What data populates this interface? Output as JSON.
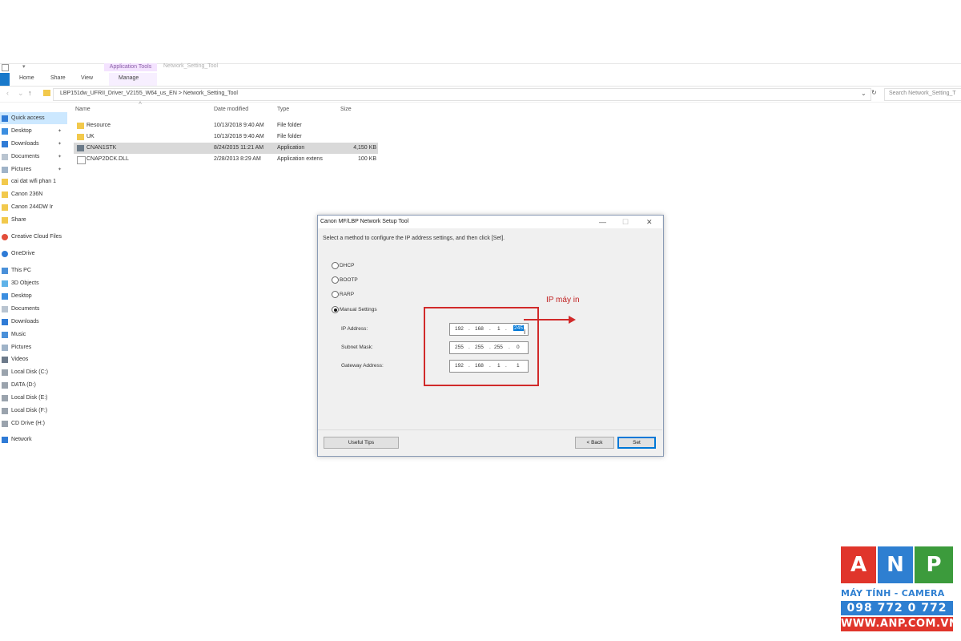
{
  "ribbon": {
    "contextual_tab": "Application Tools",
    "window_title": "Network_Setting_Tool",
    "tabs": [
      "Home",
      "Share",
      "View",
      "Manage"
    ]
  },
  "address": {
    "crumbs": "LBP151dw_UFRII_Driver_V2155_W64_us_EN  >  Network_Setting_Tool",
    "search_placeholder": "Search Network_Setting_T"
  },
  "sidebar": {
    "items": [
      {
        "label": "Quick access",
        "icon": "star-icon",
        "selected": true
      },
      {
        "label": "Desktop",
        "icon": "desktop-icon",
        "pinned": true
      },
      {
        "label": "Downloads",
        "icon": "download-icon",
        "pinned": true
      },
      {
        "label": "Documents",
        "icon": "documents-icon",
        "pinned": true
      },
      {
        "label": "Pictures",
        "icon": "pictures-icon",
        "pinned": true
      },
      {
        "label": "cai dat wifi phan 1",
        "icon": "folder-icon"
      },
      {
        "label": "Canon 236N",
        "icon": "folder-icon"
      },
      {
        "label": "Canon 244DW Ir",
        "icon": "folder-icon"
      },
      {
        "label": "Share",
        "icon": "folder-icon"
      },
      {
        "label": "Creative Cloud Files",
        "icon": "cloud-icon"
      },
      {
        "label": "OneDrive",
        "icon": "onedrive-icon"
      },
      {
        "label": "This PC",
        "icon": "computer-icon"
      },
      {
        "label": "3D Objects",
        "icon": "cube-icon"
      },
      {
        "label": "Desktop",
        "icon": "desktop-icon"
      },
      {
        "label": "Documents",
        "icon": "documents-icon"
      },
      {
        "label": "Downloads",
        "icon": "download-icon"
      },
      {
        "label": "Music",
        "icon": "music-icon"
      },
      {
        "label": "Pictures",
        "icon": "pictures-icon"
      },
      {
        "label": "Videos",
        "icon": "videos-icon"
      },
      {
        "label": "Local Disk (C:)",
        "icon": "drive-icon"
      },
      {
        "label": "DATA (D:)",
        "icon": "drive-icon"
      },
      {
        "label": "Local Disk (E:)",
        "icon": "drive-icon"
      },
      {
        "label": "Local Disk (F:)",
        "icon": "drive-icon"
      },
      {
        "label": "CD Drive (H:)",
        "icon": "cd-drive-icon"
      },
      {
        "label": "Network",
        "icon": "network-icon"
      }
    ]
  },
  "files": {
    "columns": [
      "Name",
      "Date modified",
      "Type",
      "Size"
    ],
    "rows": [
      {
        "name": "Resource",
        "date": "10/13/2018 9:40 AM",
        "type": "File folder",
        "size": "",
        "icon": "folder-icon"
      },
      {
        "name": "UK",
        "date": "10/13/2018 9:40 AM",
        "type": "File folder",
        "size": "",
        "icon": "folder-icon"
      },
      {
        "name": "CNAN1STK",
        "date": "8/24/2015 11:21 AM",
        "type": "Application",
        "size": "4,150 KB",
        "icon": "application-icon",
        "selected": true
      },
      {
        "name": "CNAP2DCK.DLL",
        "date": "2/28/2013 8:29 AM",
        "type": "Application extens",
        "size": "100 KB",
        "icon": "dll-icon"
      }
    ]
  },
  "dialog": {
    "title": "Canon MF/LBP Network Setup Tool",
    "instruction": "Select a method to configure the IP address settings, and then click [Set].",
    "options": [
      "DHCP",
      "BOOTP",
      "RARP",
      "Manual Settings"
    ],
    "selected_option": "Manual Settings",
    "fields": [
      {
        "label": "IP Address:",
        "octets": [
          "192",
          "168",
          "1",
          "245"
        ]
      },
      {
        "label": "Subnet Mask:",
        "octets": [
          "255",
          "255",
          "255",
          "0"
        ]
      },
      {
        "label": "Gateway Address:",
        "octets": [
          "192",
          "168",
          "1",
          "1"
        ]
      }
    ],
    "buttons": {
      "tips": "Useful Tips",
      "back": "< Back",
      "set": "Set"
    }
  },
  "annotation": {
    "label": "IP máy in",
    "color": "#d12a2a"
  },
  "logo": {
    "letters": [
      "A",
      "N",
      "P"
    ],
    "colors": [
      "#e0352b",
      "#2e7fd1",
      "#3c9b3c"
    ],
    "line1": "MÁY TÍNH - CAMERA",
    "line2": "098 772 0 772",
    "line3": "WWW.ANP.COM.VN"
  }
}
